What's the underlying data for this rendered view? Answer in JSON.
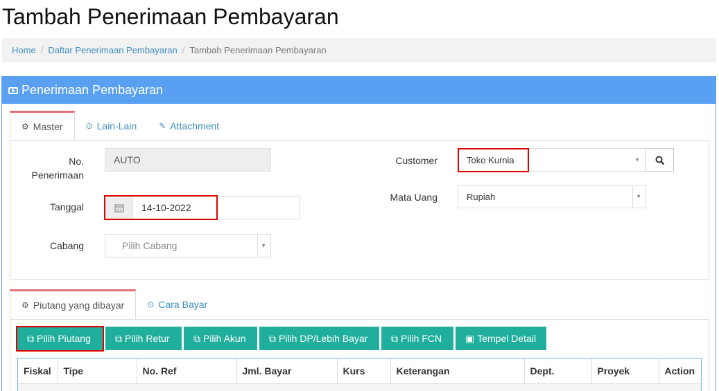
{
  "page": {
    "title": "Tambah Penerimaan Pembayaran"
  },
  "breadcrumb": {
    "items": [
      "Home",
      "Daftar Penerimaan Pembayaran",
      "Tambah Penerimaan Pembayaran"
    ],
    "separator": "/"
  },
  "panel": {
    "title": "Penerimaan Pembayaran",
    "icon": "money-icon",
    "color": "#5aa0f2"
  },
  "top_tabs": [
    {
      "label": "Master",
      "icon": "gears-icon",
      "active": true
    },
    {
      "label": "Lain-Lain",
      "icon": "check-circle-icon",
      "active": false
    },
    {
      "label": "Attachment",
      "icon": "paperclip-icon",
      "active": false
    }
  ],
  "form": {
    "no_penerimaan": {
      "label_line1": "No.",
      "label_line2": "Penerimaan",
      "value": "AUTO"
    },
    "tanggal": {
      "label": "Tanggal",
      "value": "14-10-2022"
    },
    "cabang": {
      "label": "Cabang",
      "placeholder": "Pilih Cabang"
    },
    "customer": {
      "label": "Customer",
      "value": "Toko Kurnia"
    },
    "mata_uang": {
      "label": "Mata Uang",
      "value": "Rupiah"
    }
  },
  "bottom_tabs": [
    {
      "label": "Piutang yang dibayar",
      "icon": "gears-icon",
      "active": true
    },
    {
      "label": "Cara Bayar",
      "icon": "check-circle-icon",
      "active": false
    }
  ],
  "buttons": [
    {
      "label": "Pilih Piutang",
      "icon": "copy-icon"
    },
    {
      "label": "Pilih Retur",
      "icon": "copy-icon"
    },
    {
      "label": "Pilih Akun",
      "icon": "copy-icon"
    },
    {
      "label": "Pilih DP/Lebih Bayar",
      "icon": "copy-icon"
    },
    {
      "label": "Pilih FCN",
      "icon": "copy-icon"
    },
    {
      "label": "Tempel Detail",
      "icon": "paste-icon"
    }
  ],
  "table": {
    "columns": [
      "Fiskal",
      "Tipe",
      "No. Ref",
      "Jml. Bayar",
      "Kurs",
      "Keterangan",
      "Dept.",
      "Proyek",
      "Action"
    ]
  },
  "colors": {
    "accent": "#1faf9c",
    "highlight": "#e00000",
    "link": "#3c8dbc"
  }
}
